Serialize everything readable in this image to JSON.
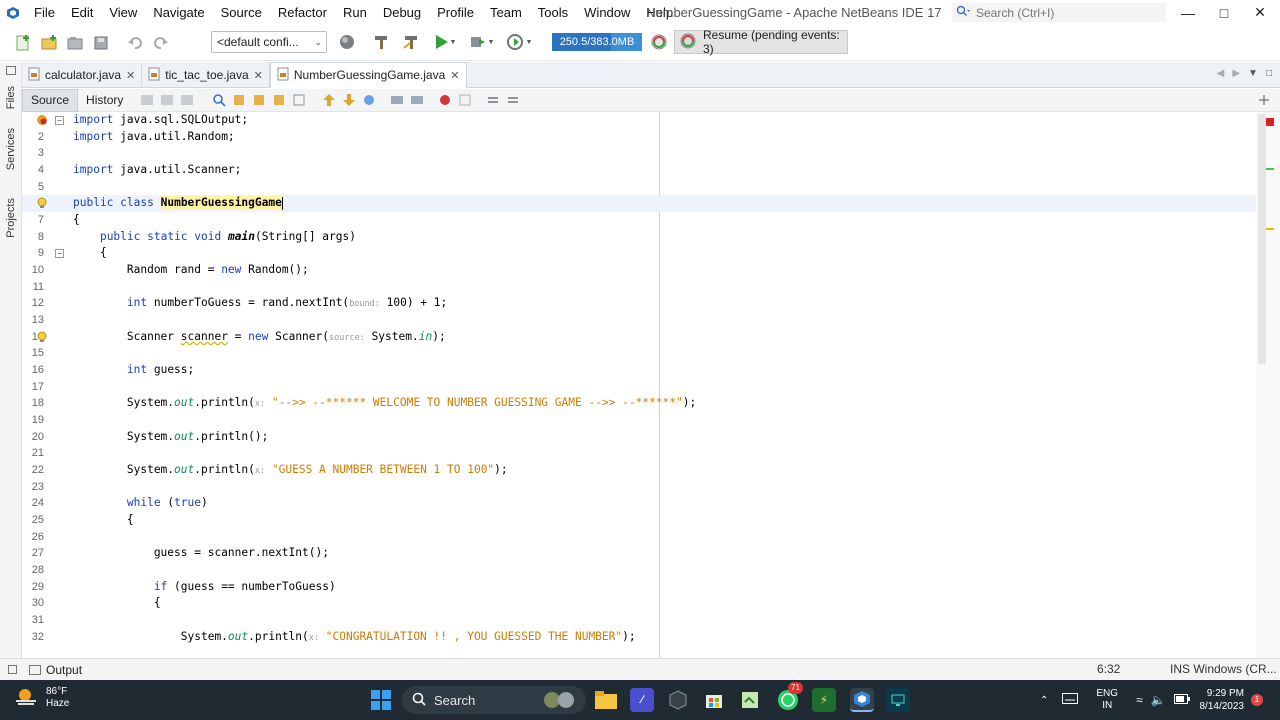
{
  "window": {
    "title": "NumberGuessingGame - Apache NetBeans IDE 17",
    "search_placeholder": "Search (Ctrl+I)"
  },
  "menu": [
    "File",
    "Edit",
    "View",
    "Navigate",
    "Source",
    "Refactor",
    "Run",
    "Debug",
    "Profile",
    "Team",
    "Tools",
    "Window",
    "Help"
  ],
  "toolbar": {
    "config": "<default confi...",
    "memory": "250.5/383.0MB",
    "memory_fraction": 0.654,
    "resume": "Resume (pending events: 3)"
  },
  "side_tabs": [
    "Projects",
    "Services",
    "Files"
  ],
  "tabs": [
    {
      "label": "calculator.java",
      "active": false
    },
    {
      "label": "tic_tac_toe.java",
      "active": false
    },
    {
      "label": "NumberGuessingGame.java",
      "active": true
    }
  ],
  "editor": {
    "modes": [
      "Source",
      "History"
    ],
    "active_mode": "Source",
    "current_line": 6,
    "lines": [
      {
        "n": "1",
        "html": "<span class='kw'>import</span> java.sql.SQLOutput;"
      },
      {
        "n": "2",
        "html": "<span class='kw'>import</span> java.util.Random;"
      },
      {
        "n": "3",
        "html": ""
      },
      {
        "n": "4",
        "html": "<span class='kw'>import</span> java.util.Scanner;"
      },
      {
        "n": "5",
        "html": ""
      },
      {
        "n": "6",
        "html": "<span class='kw'>public</span> <span class='kw'>class</span> <span class='cls-hl'>NumberGuessingGame</span><span class='caret'></span>"
      },
      {
        "n": "7",
        "html": "{"
      },
      {
        "n": "8",
        "html": "    <span class='kw'>public</span> <span class='kw'>static</span> <span class='kw'>void</span> <span class='meth-decl'>main</span>(String[] args)"
      },
      {
        "n": "9",
        "html": "    {"
      },
      {
        "n": "10",
        "html": "        Random rand = <span class='kw'>new</span> Random();"
      },
      {
        "n": "11",
        "html": ""
      },
      {
        "n": "12",
        "html": "        <span class='kw'>int</span> numberToGuess = rand.nextInt(<span class='hint'>bound:</span> 100) + 1;"
      },
      {
        "n": "13",
        "html": ""
      },
      {
        "n": "14",
        "html": "        Scanner <span class='warn-ul'>scanner</span> = <span class='kw'>new</span> Scanner(<span class='hint'>source:</span> System.<span class='fld'>in</span>);"
      },
      {
        "n": "15",
        "html": ""
      },
      {
        "n": "16",
        "html": "        <span class='kw'>int</span> guess;"
      },
      {
        "n": "17",
        "html": ""
      },
      {
        "n": "18",
        "html": "        System.<span class='fld'>out</span>.println(<span class='hint'>x:</span> <span class='str'>\"-->> --****** WELCOME TO NUMBER GUESSING GAME -->> --******\"</span>);"
      },
      {
        "n": "19",
        "html": ""
      },
      {
        "n": "20",
        "html": "        System.<span class='fld'>out</span>.println();"
      },
      {
        "n": "21",
        "html": ""
      },
      {
        "n": "22",
        "html": "        System.<span class='fld'>out</span>.println(<span class='hint'>x:</span> <span class='str'>\"GUESS A NUMBER BETWEEN 1 TO 100\"</span>);"
      },
      {
        "n": "23",
        "html": ""
      },
      {
        "n": "24",
        "html": "        <span class='kw'>while</span> (<span class='kw'>true</span>)"
      },
      {
        "n": "25",
        "html": "        {"
      },
      {
        "n": "26",
        "html": ""
      },
      {
        "n": "27",
        "html": "            guess = scanner.nextInt();"
      },
      {
        "n": "28",
        "html": ""
      },
      {
        "n": "29",
        "html": "            <span class='kw'>if</span> (guess == numberToGuess)"
      },
      {
        "n": "30",
        "html": "            {"
      },
      {
        "n": "31",
        "html": ""
      },
      {
        "n": "32",
        "html": "                System.<span class='fld'>out</span>.println(<span class='hint'>x:</span> <span class='str'>\"CONGRATULATION !! , YOU GUESSED THE NUMBER\"</span>);"
      }
    ]
  },
  "status": {
    "output_label": "Output",
    "position": "6:32",
    "insert_mode": "INS Windows (CR..."
  },
  "taskbar": {
    "weather_temp": "86°F",
    "weather_desc": "Haze",
    "search_label": "Search",
    "lang": "ENG",
    "region": "IN",
    "time": "9:29 PM",
    "date": "8/14/2023",
    "whatsapp_badge": "71"
  }
}
